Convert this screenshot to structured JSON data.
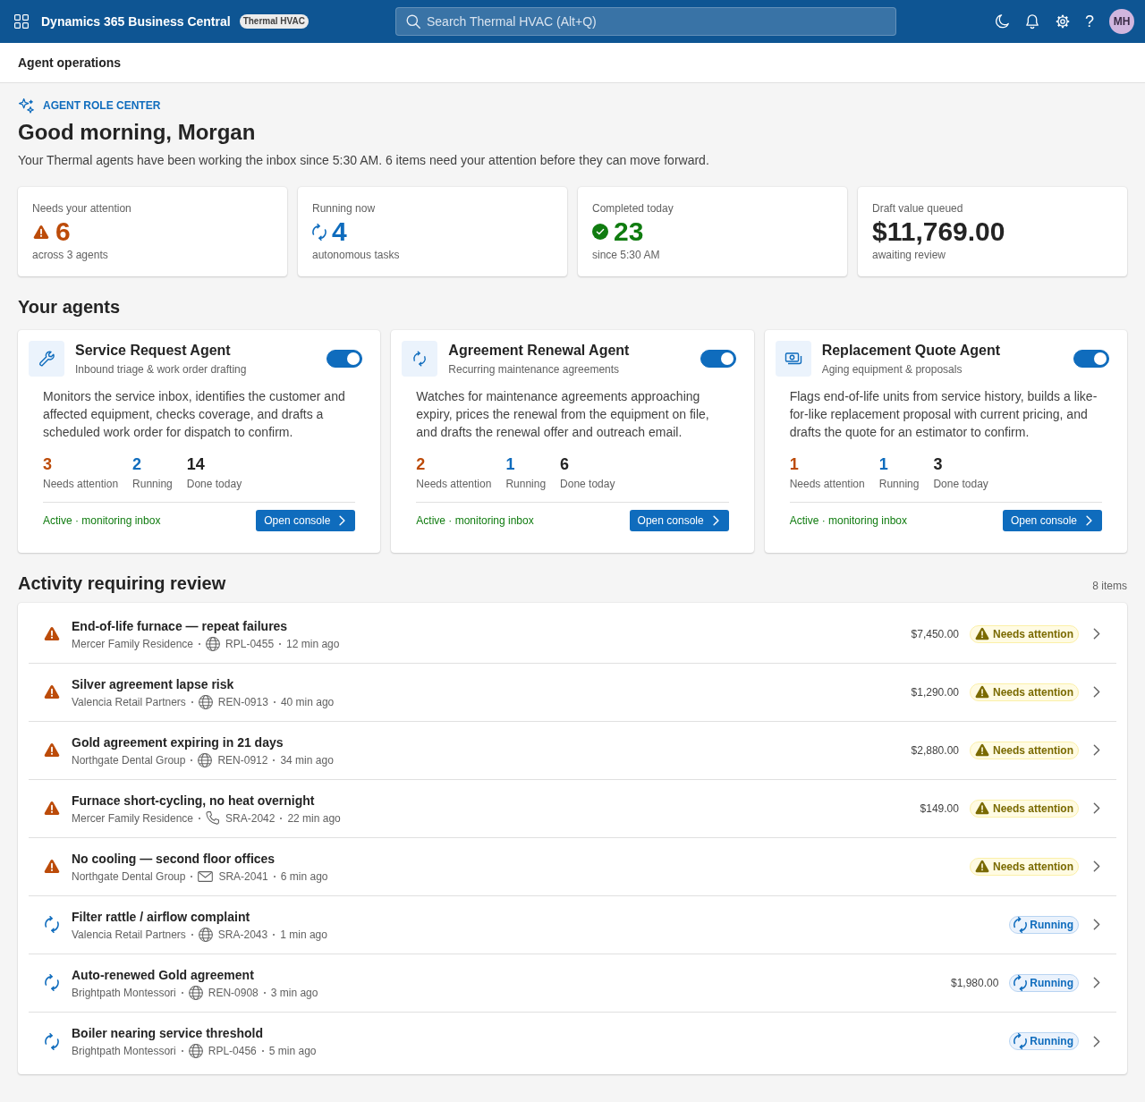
{
  "app_bar": {
    "app_name": "Dynamics 365 Business Central",
    "environment": "Thermal HVAC",
    "search": {
      "placeholder": "Search Thermal HVAC (Alt+Q)"
    },
    "help": "?",
    "avatar_initials": "MH"
  },
  "page_header": {
    "title": "Agent operations"
  },
  "hero": {
    "eyebrow": "AGENT ROLE CENTER",
    "greeting": "Good morning, Morgan",
    "summary": "Your Thermal agents have been working the inbox since 5:30 AM. 6 items need your attention before they can move forward."
  },
  "kpis": [
    {
      "kind": "attention",
      "label": "Needs your attention",
      "value": "6",
      "caption": "across 3 agents"
    },
    {
      "kind": "running",
      "label": "Running now",
      "value": "4",
      "caption": "autonomous tasks"
    },
    {
      "kind": "completed",
      "label": "Completed today",
      "value": "23",
      "caption": "since 5:30 AM"
    },
    {
      "kind": "value",
      "label": "Draft value queued",
      "value": "$11,769.00",
      "caption": "awaiting review"
    }
  ],
  "agents_section": {
    "title": "Your agents",
    "agents": [
      {
        "kind": "service",
        "name": "Service Request Agent",
        "subtitle": "Inbound triage & work order drafting",
        "on": true,
        "description": "Monitors the service inbox, identifies the customer and affected equipment, checks coverage, and drafts a scheduled work order for dispatch to confirm.",
        "stats": [
          {
            "kind": "attention",
            "value": "3",
            "label": "Needs attention"
          },
          {
            "kind": "running",
            "value": "2",
            "label": "Running"
          },
          {
            "kind": "done",
            "value": "14",
            "label": "Done today"
          }
        ],
        "status": "Active · monitoring inbox",
        "button": "Open console"
      },
      {
        "kind": "renewal",
        "name": "Agreement Renewal Agent",
        "subtitle": "Recurring maintenance agreements",
        "on": true,
        "description": "Watches for maintenance agreements approaching expiry, prices the renewal from the equipment on file, and drafts the renewal offer and outreach email.",
        "stats": [
          {
            "kind": "attention",
            "value": "2",
            "label": "Needs attention"
          },
          {
            "kind": "running",
            "value": "1",
            "label": "Running"
          },
          {
            "kind": "done",
            "value": "6",
            "label": "Done today"
          }
        ],
        "status": "Active · monitoring inbox",
        "button": "Open console"
      },
      {
        "kind": "quote",
        "name": "Replacement Quote Agent",
        "subtitle": "Aging equipment & proposals",
        "on": true,
        "description": "Flags end-of-life units from service history, builds a like-for-like replacement proposal with current pricing, and drafts the quote for an estimator to confirm.",
        "stats": [
          {
            "kind": "attention",
            "value": "1",
            "label": "Needs attention"
          },
          {
            "kind": "running",
            "value": "1",
            "label": "Running"
          },
          {
            "kind": "done",
            "value": "3",
            "label": "Done today"
          }
        ],
        "status": "Active · monitoring inbox",
        "button": "Open console"
      }
    ]
  },
  "activity": {
    "title": "Activity requiring review",
    "count": "8 items",
    "rows": [
      {
        "kind": "attention",
        "title": "End-of-life furnace — repeat failures",
        "customer": "Mercer Family Residence",
        "channel": {
          "kind": "web"
        },
        "reference": "RPL-0455",
        "time": "12 min ago",
        "amount": "$7,450.00",
        "status": "Needs attention"
      },
      {
        "kind": "attention",
        "title": "Silver agreement lapse risk",
        "customer": "Valencia Retail Partners",
        "channel": {
          "kind": "web"
        },
        "reference": "REN-0913",
        "time": "40 min ago",
        "amount": "$1,290.00",
        "status": "Needs attention"
      },
      {
        "kind": "attention",
        "title": "Gold agreement expiring in 21 days",
        "customer": "Northgate Dental Group",
        "channel": {
          "kind": "web"
        },
        "reference": "REN-0912",
        "time": "34 min ago",
        "amount": "$2,880.00",
        "status": "Needs attention"
      },
      {
        "kind": "attention",
        "title": "Furnace short-cycling, no heat overnight",
        "customer": "Mercer Family Residence",
        "channel": {
          "kind": "phone"
        },
        "reference": "SRA-2042",
        "time": "22 min ago",
        "amount": "$149.00",
        "status": "Needs attention"
      },
      {
        "kind": "attention",
        "title": "No cooling — second floor offices",
        "customer": "Northgate Dental Group",
        "channel": {
          "kind": "email"
        },
        "reference": "SRA-2041",
        "time": "6 min ago",
        "status": "Needs attention"
      },
      {
        "kind": "running",
        "title": "Filter rattle / airflow complaint",
        "customer": "Valencia Retail Partners",
        "channel": {
          "kind": "web"
        },
        "reference": "SRA-2043",
        "time": "1 min ago",
        "status": "Running"
      },
      {
        "kind": "running",
        "title": "Auto-renewed Gold agreement",
        "customer": "Brightpath Montessori",
        "channel": {
          "kind": "web"
        },
        "reference": "REN-0908",
        "time": "3 min ago",
        "amount": "$1,980.00",
        "status": "Running"
      },
      {
        "kind": "running",
        "title": "Boiler nearing service threshold",
        "customer": "Brightpath Montessori",
        "channel": {
          "kind": "web"
        },
        "reference": "RPL-0456",
        "time": "5 min ago",
        "status": "Running"
      }
    ]
  }
}
